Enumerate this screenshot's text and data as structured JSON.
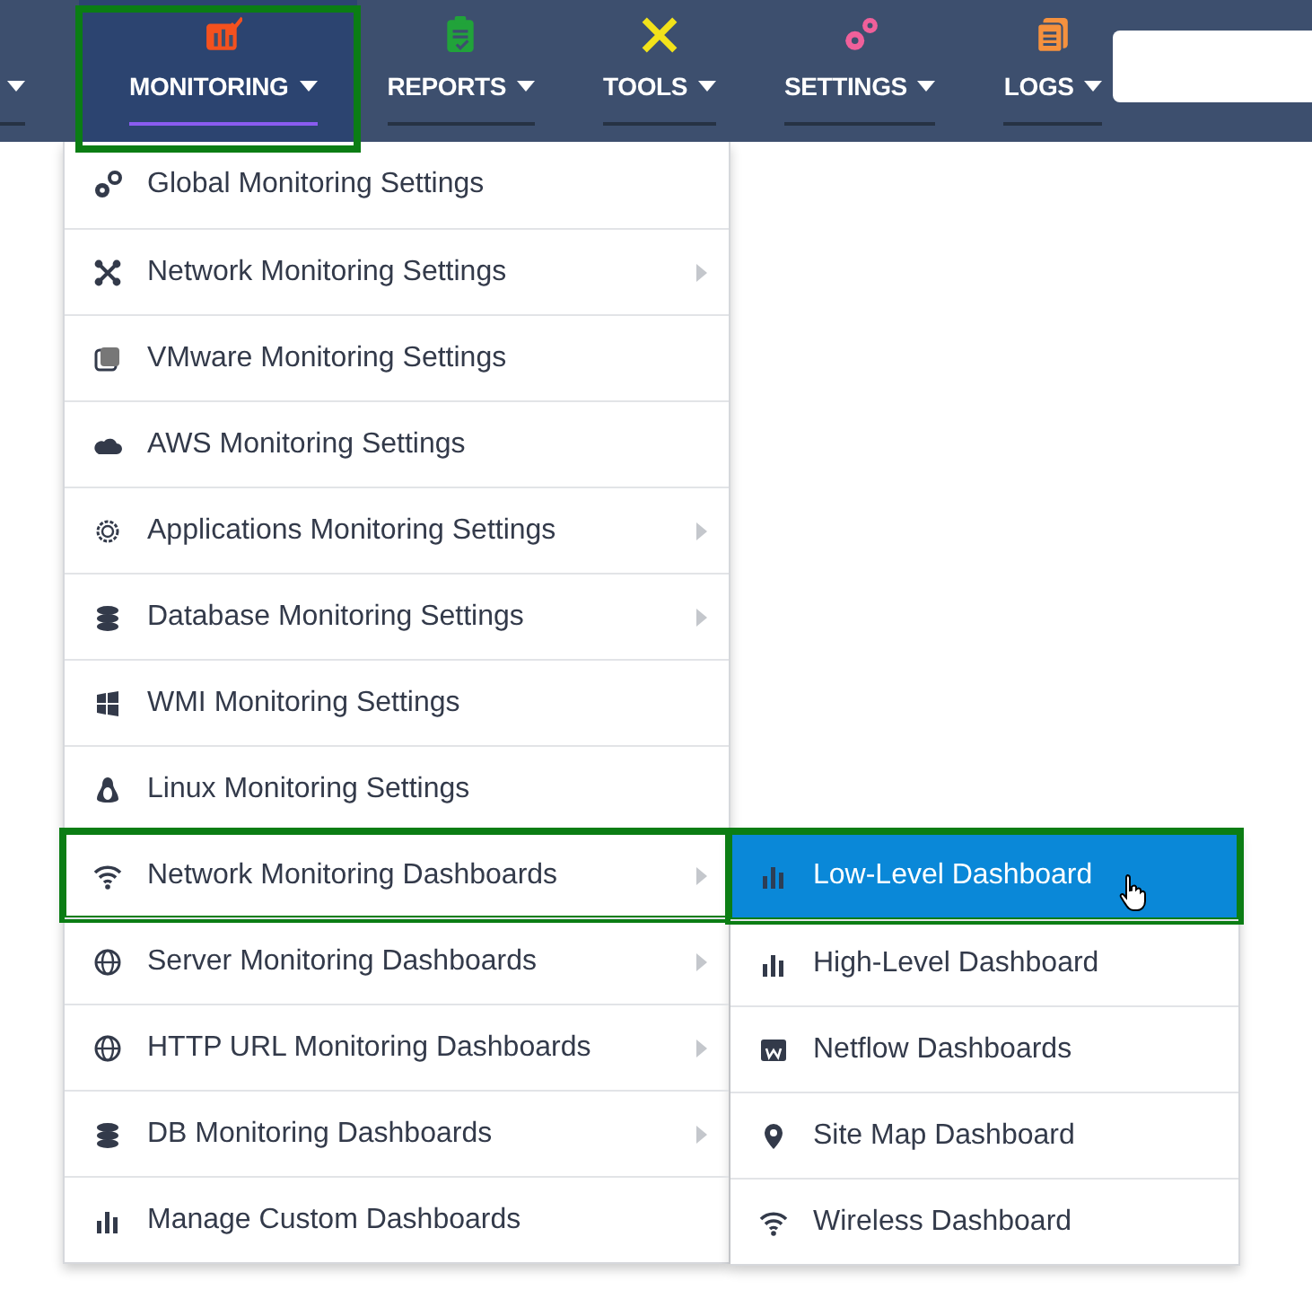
{
  "nav": [
    {
      "selected": false,
      "highlighted": false
    },
    {
      "label": "MONITORING",
      "color": "#f4511e",
      "selected": true,
      "highlighted": true
    },
    {
      "label": "REPORTS",
      "color": "#21a33a",
      "selected": false,
      "highlighted": false
    },
    {
      "label": "TOOLS",
      "color": "#f2e21a",
      "selected": false,
      "highlighted": false
    },
    {
      "label": "SETTINGS",
      "color": "#f0609a",
      "selected": false,
      "highlighted": false
    },
    {
      "label": "LOGS",
      "color": "#f5913e",
      "selected": false,
      "highlighted": false
    }
  ],
  "menu": [
    {
      "label": "Global Monitoring Settings",
      "has_submenu": false,
      "highlighted": false
    },
    {
      "label": "Network Monitoring Settings",
      "has_submenu": true,
      "highlighted": false
    },
    {
      "label": "VMware Monitoring Settings",
      "has_submenu": false,
      "highlighted": false
    },
    {
      "label": "AWS Monitoring Settings",
      "has_submenu": false,
      "highlighted": false
    },
    {
      "label": "Applications Monitoring Settings",
      "has_submenu": true,
      "highlighted": false
    },
    {
      "label": "Database Monitoring Settings",
      "has_submenu": true,
      "highlighted": false
    },
    {
      "label": "WMI Monitoring Settings",
      "has_submenu": false,
      "highlighted": false
    },
    {
      "label": "Linux Monitoring Settings",
      "has_submenu": false,
      "highlighted": false
    },
    {
      "label": "Network Monitoring Dashboards",
      "has_submenu": true,
      "highlighted": true
    },
    {
      "label": "Server Monitoring Dashboards",
      "has_submenu": true,
      "highlighted": false
    },
    {
      "label": "HTTP URL Monitoring Dashboards",
      "has_submenu": true,
      "highlighted": false
    },
    {
      "label": "DB Monitoring Dashboards",
      "has_submenu": true,
      "highlighted": false
    },
    {
      "label": "Manage Custom Dashboards",
      "has_submenu": false,
      "highlighted": false
    }
  ],
  "submenu": [
    {
      "label": "Low-Level Dashboard",
      "selected": true,
      "highlighted": true
    },
    {
      "label": "High-Level Dashboard",
      "selected": false,
      "highlighted": false
    },
    {
      "label": "Netflow Dashboards",
      "selected": false,
      "highlighted": false
    },
    {
      "label": "Site Map Dashboard",
      "selected": false,
      "highlighted": false
    },
    {
      "label": "Wireless Dashboard",
      "selected": false,
      "highlighted": false
    }
  ]
}
